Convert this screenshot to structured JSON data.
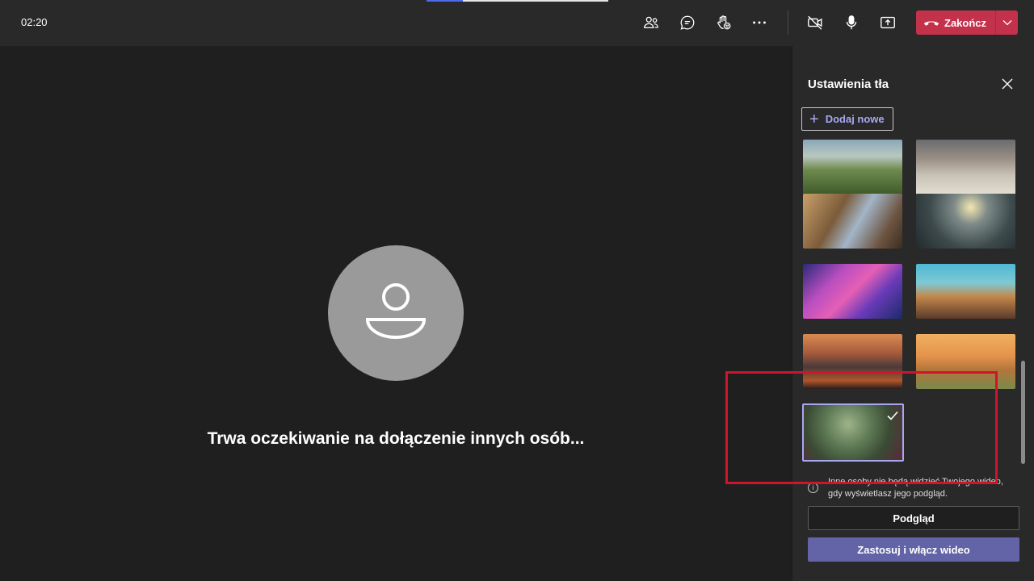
{
  "topbar": {
    "timer": "02:20",
    "icons": [
      "people-icon",
      "chat-icon",
      "raise-hand-icon",
      "more-options-icon",
      "camera-off-icon",
      "microphone-icon",
      "share-screen-icon"
    ],
    "end_call_label": "Zakończ",
    "colors": {
      "end_call": "#c4314b",
      "background": "#292929"
    }
  },
  "stage": {
    "waiting_message": "Trwa oczekiwanie na dołączenie innych osób..."
  },
  "panel": {
    "title": "Ustawienia tła",
    "add_new_label": "Dodaj nowe",
    "backgrounds": [
      {
        "name": "mountain-valley"
      },
      {
        "name": "desert-ruins"
      },
      {
        "name": "fantasy-street"
      },
      {
        "name": "sci-fi-landscape"
      },
      {
        "name": "galaxy-nebula"
      },
      {
        "name": "alien-shore"
      },
      {
        "name": "autumn-city"
      },
      {
        "name": "sunset-field"
      },
      {
        "name": "misty-forest",
        "selected": true
      }
    ],
    "info_text": "Inne osoby nie będą widzieć Twojego wideo, gdy wyświetlasz jego podgląd.",
    "preview_label": "Podgląd",
    "apply_label": "Zastosuj i włącz wideo",
    "colors": {
      "accent": "#6264a7",
      "accent_light": "#a7a8f2"
    }
  },
  "annotation": {
    "color": "#d0142b"
  }
}
